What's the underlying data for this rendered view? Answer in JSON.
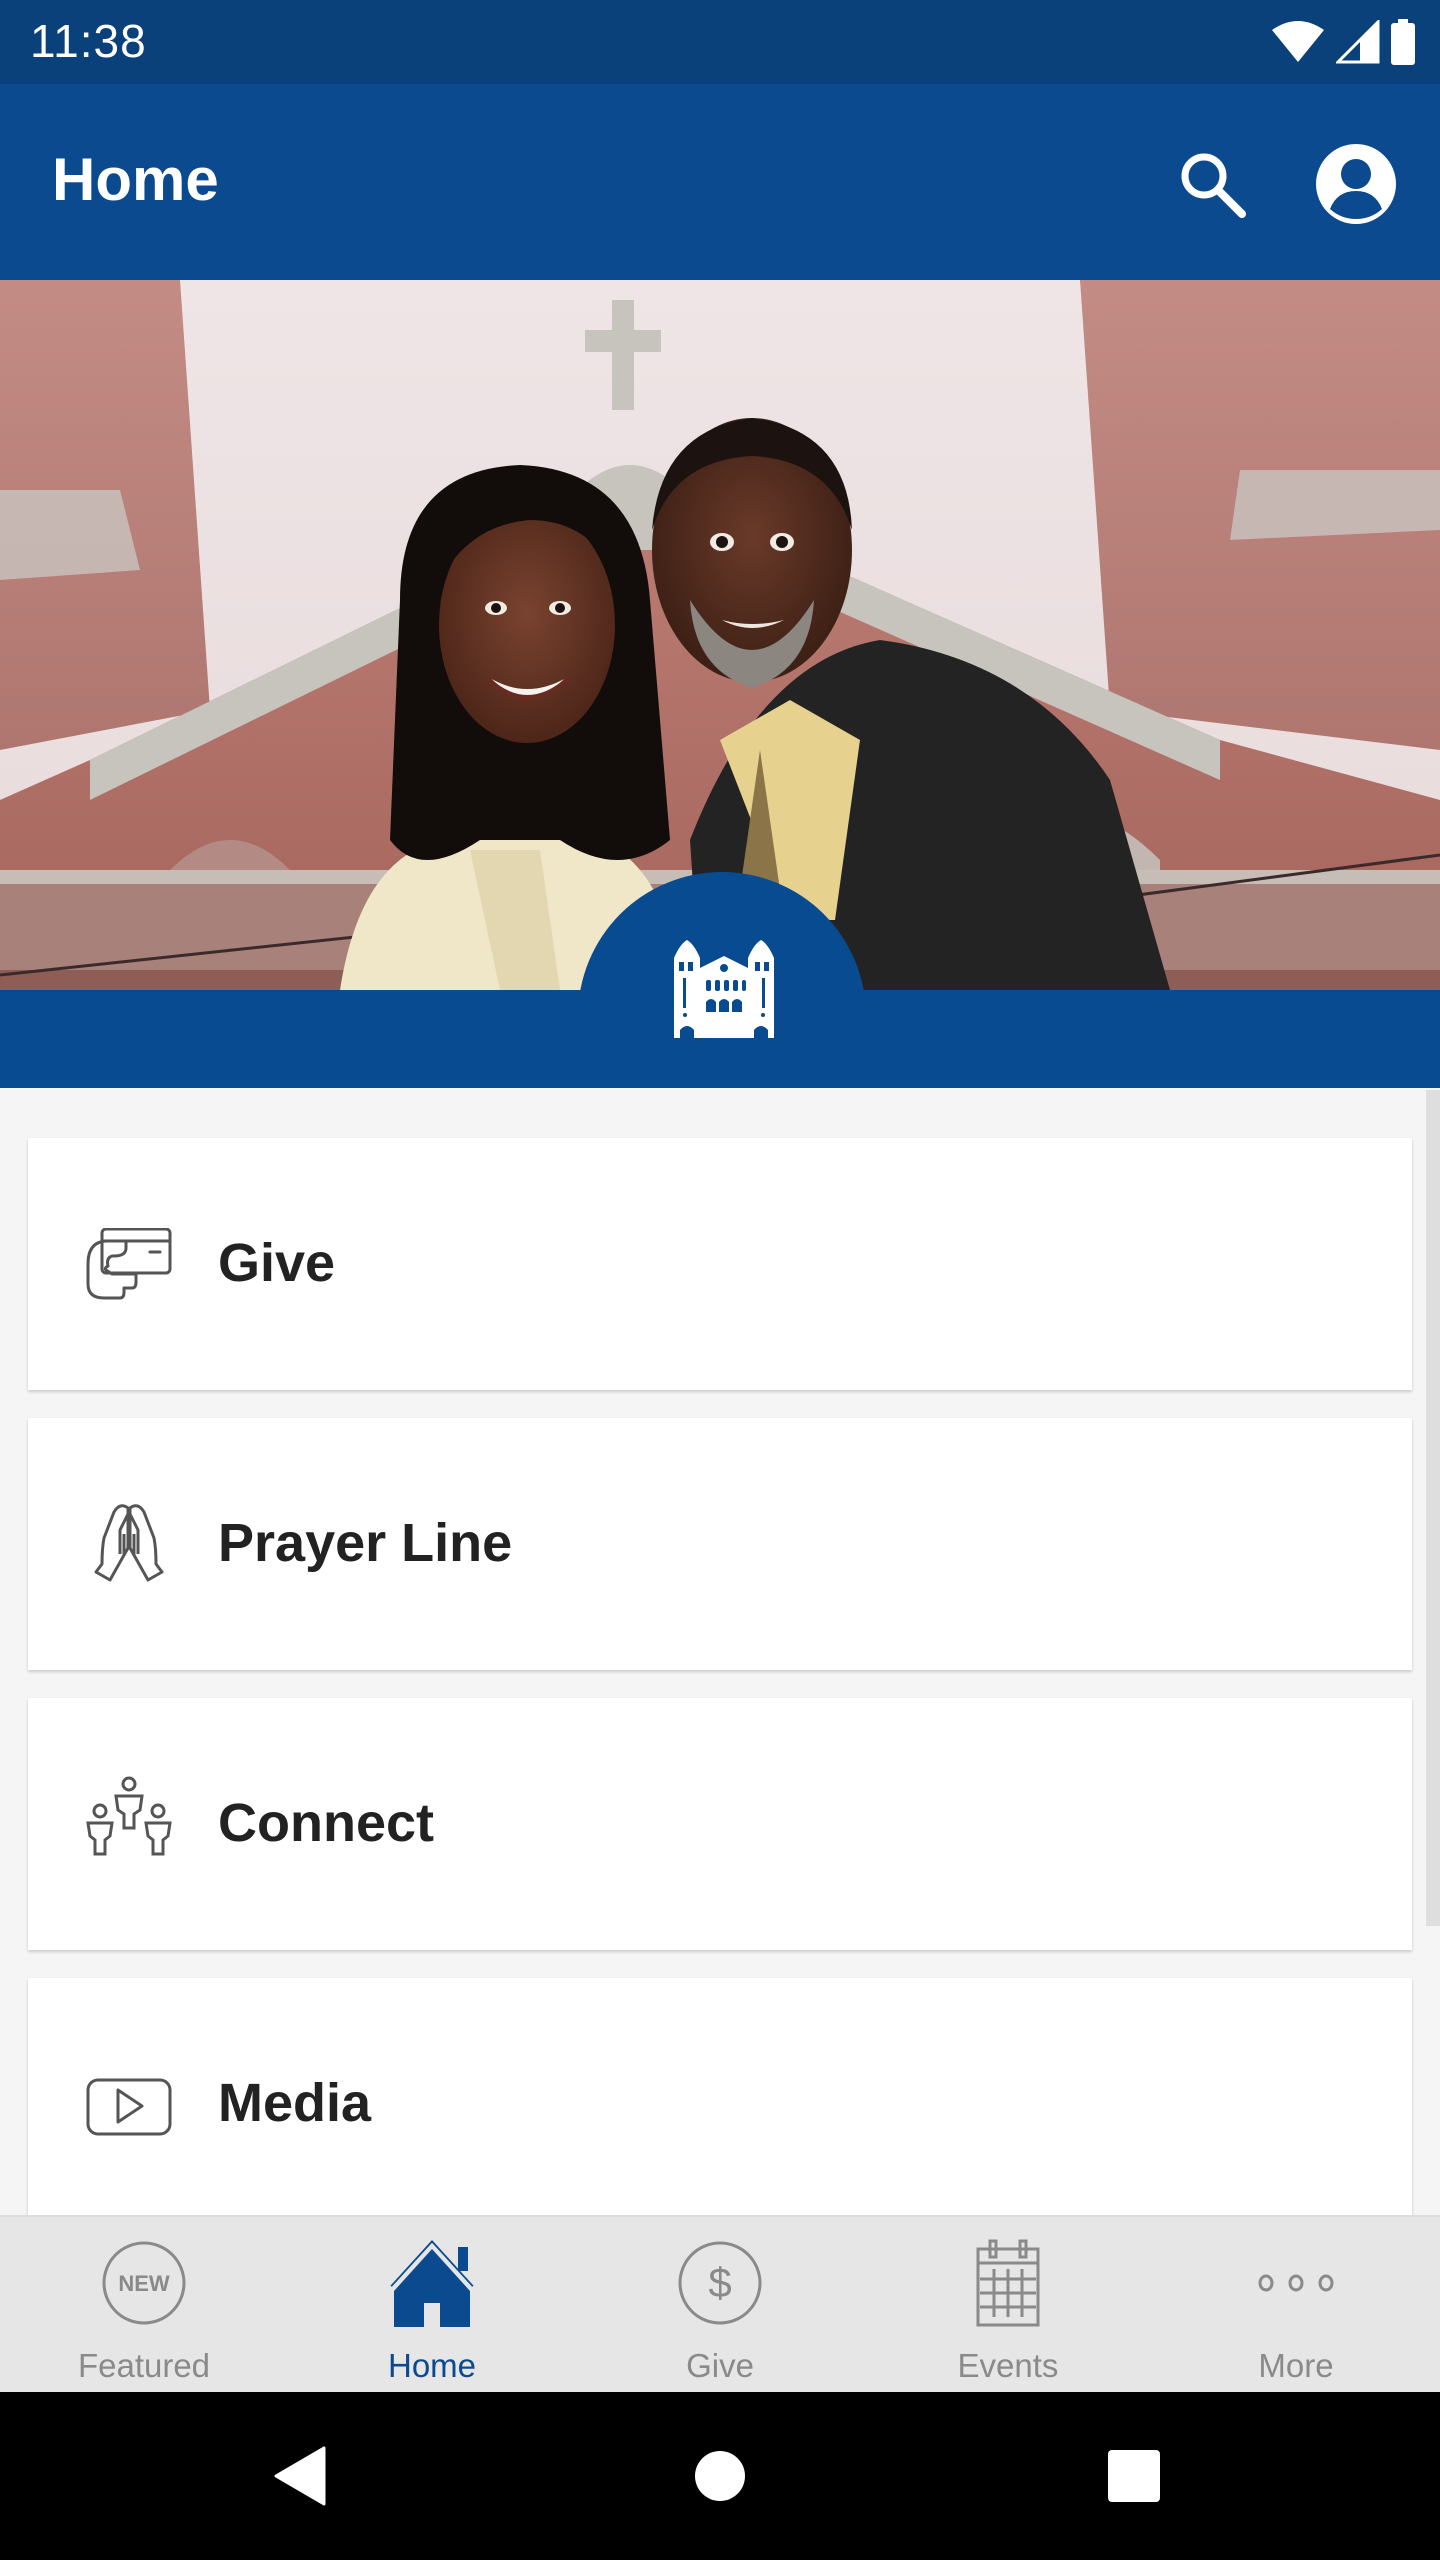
{
  "status_bar": {
    "time": "11:38",
    "icons": [
      "wifi-icon",
      "cellular-signal-icon",
      "battery-icon"
    ]
  },
  "app_bar": {
    "title": "Home",
    "actions": [
      {
        "name": "search",
        "icon": "search-icon"
      },
      {
        "name": "profile",
        "icon": "account-circle-icon"
      }
    ]
  },
  "hero": {
    "image_description": "Pastor couple in front of brick church facade",
    "logo_icon": "church-building-icon"
  },
  "menu": {
    "items": [
      {
        "label": "Give",
        "icon": "hand-card-icon"
      },
      {
        "label": "Prayer Line",
        "icon": "praying-hands-icon"
      },
      {
        "label": "Connect",
        "icon": "people-group-icon"
      },
      {
        "label": "Media",
        "icon": "play-video-icon"
      }
    ]
  },
  "bottom_nav": {
    "active": "Home",
    "items": [
      {
        "label": "Featured",
        "icon": "new-badge-icon",
        "badge_text": "NEW"
      },
      {
        "label": "Home",
        "icon": "home-icon"
      },
      {
        "label": "Give",
        "icon": "dollar-circle-icon",
        "symbol": "$"
      },
      {
        "label": "Events",
        "icon": "calendar-icon"
      },
      {
        "label": "More",
        "icon": "more-dots-icon"
      }
    ]
  },
  "system_nav": {
    "buttons": [
      "back",
      "home",
      "recents"
    ]
  },
  "colors": {
    "brand_blue": "#0b4a8e",
    "status_bar_blue": "#0a417b",
    "active_tab": "#0b4a8e",
    "inactive_tab": "#8a8a8a",
    "page_background": "#f5f5f5",
    "card_text": "#222222"
  }
}
